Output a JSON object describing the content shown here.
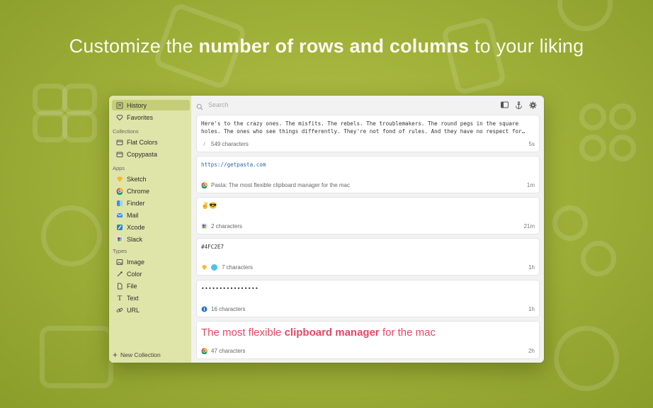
{
  "headline": {
    "pre": "Customize the",
    "bold": "number of rows and columns",
    "post": "to your liking"
  },
  "colors": {
    "background": "#a3b43c",
    "sidebar": "#dfe4a9",
    "sidebar_active": "#c5cd79",
    "accent_pink": "#e04a63",
    "swatch": "#4FC2E7"
  },
  "sidebar": {
    "history": "History",
    "favorites": "Favorites",
    "collections_header": "Collections",
    "collections": [
      "Flat Colors",
      "Copypasta"
    ],
    "apps_header": "Apps",
    "apps": [
      "Sketch",
      "Chrome",
      "Finder",
      "Mail",
      "Xcode",
      "Slack"
    ],
    "types_header": "Types",
    "types": [
      "Image",
      "Color",
      "File",
      "Text",
      "URL"
    ],
    "new_collection": "New Collection"
  },
  "search": {
    "placeholder": "Search"
  },
  "toolbar": {
    "icons": [
      "sidebar-toggle-icon",
      "anchor-icon",
      "gear-icon"
    ]
  },
  "items": [
    {
      "content": "Here's to the crazy ones. The misfits. The rebels. The troublemakers. The round pegs in the square holes. The ones who see things differently. They're not fond of rules. And they have no respect for…",
      "meta": "549 characters",
      "time": "5s",
      "icon": "text-slash-icon"
    },
    {
      "content": "https://getpasta.com",
      "meta": "Pasta: The most flexible clipboard manager for the mac",
      "time": "1m",
      "icon": "chrome-icon"
    },
    {
      "content": "✌️😎",
      "meta": "2 characters",
      "time": "21m",
      "icon": "slack-icon"
    },
    {
      "content": "#4FC2E7",
      "meta": "7 characters",
      "time": "1h",
      "icon": "sketch-icon"
    },
    {
      "content": "••••••••••••••••",
      "meta": "16 characters",
      "time": "1h",
      "icon": "password-manager-icon"
    },
    {
      "content_pre": "The most flexible",
      "content_bold": "clipboard manager",
      "content_post": "for the mac",
      "meta": "47 characters",
      "time": "2h",
      "icon": "chrome-icon"
    }
  ]
}
